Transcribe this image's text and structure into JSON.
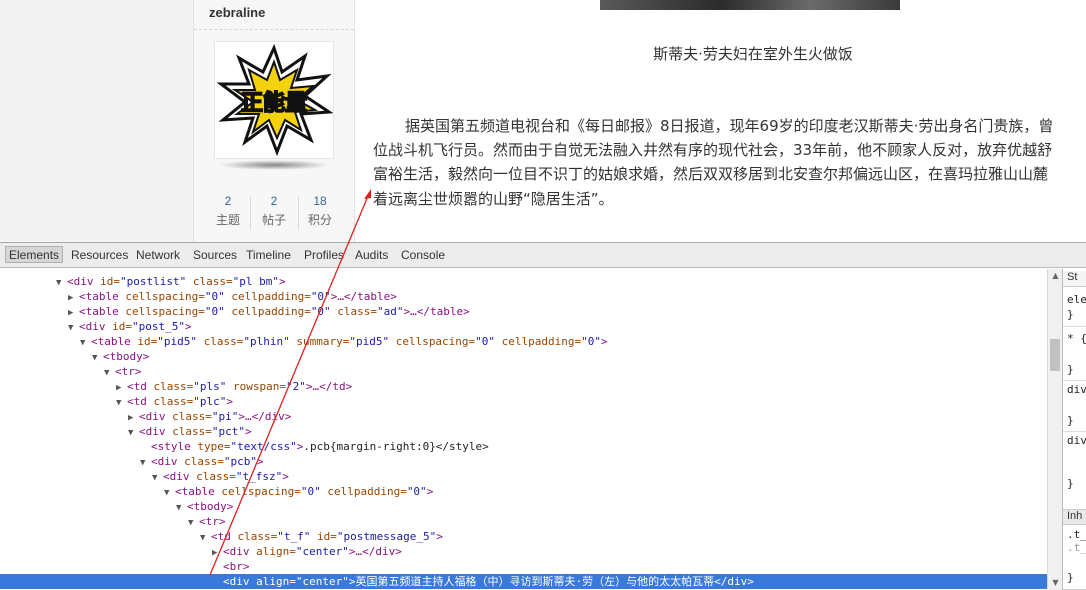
{
  "profile": {
    "username": "zebraline",
    "avatar_alt": "正能量",
    "stats": [
      {
        "value": "2",
        "label": "主题"
      },
      {
        "value": "2",
        "label": "帖子"
      },
      {
        "value": "18",
        "label": "积分"
      }
    ]
  },
  "article": {
    "caption": "斯蒂夫·劳夫妇在室外生火做饭",
    "lines": [
      "据英国第五频道电视台和《每日邮报》8日报道，现年69岁的印度老汉斯蒂夫·劳出身名门贵族，曾",
      "位战斗机飞行员。然而由于自觉无法融入井然有序的现代社会，33年前，他不顾家人反对，放弃优越舒",
      "富裕生活，毅然向一位目不识丁的姑娘求婚，然后双双移居到北安查尔邦偏远山区，在喜玛拉雅山山麓",
      "着远离尘世烦嚣的山野“隐居生活”。",
      "………………"
    ]
  },
  "devtools": {
    "tabs": [
      "Elements",
      "Resources",
      "Network",
      "Sources",
      "Timeline",
      "Profiles",
      "Audits",
      "Console"
    ],
    "active_tab": "Elements",
    "dom_lines": [
      {
        "a": "▼",
        "tag": "div",
        "attrs": [
          [
            "id",
            "postlist"
          ],
          [
            "class",
            "pl bm"
          ]
        ],
        "end": ""
      },
      {
        "a": "▶",
        "tag": "table",
        "attrs": [
          [
            "cellspacing",
            "0"
          ],
          [
            "cellpadding",
            "0"
          ]
        ],
        "end": "…</table>"
      },
      {
        "a": "▶",
        "tag": "table",
        "attrs": [
          [
            "cellspacing",
            "0"
          ],
          [
            "cellpadding",
            "0"
          ],
          [
            "class",
            "ad"
          ]
        ],
        "end": "…</table>"
      },
      {
        "a": "▼",
        "tag": "div",
        "attrs": [
          [
            "id",
            "post_5"
          ]
        ],
        "end": ""
      },
      {
        "a": "▼",
        "tag": "table",
        "attrs": [
          [
            "id",
            "pid5"
          ],
          [
            "class",
            "plhin"
          ],
          [
            "summary",
            "pid5"
          ],
          [
            "cellspacing",
            "0"
          ],
          [
            "cellpadding",
            "0"
          ]
        ],
        "end": ""
      },
      {
        "a": "▼",
        "tag": "tbody",
        "attrs": [],
        "end": ""
      },
      {
        "a": "▼",
        "tag": "tr",
        "attrs": [],
        "end": ""
      },
      {
        "a": "▶",
        "tag": "td",
        "attrs": [
          [
            "class",
            "pls"
          ],
          [
            "rowspan",
            "2"
          ]
        ],
        "end": "…</td>"
      },
      {
        "a": "▼",
        "tag": "td",
        "attrs": [
          [
            "class",
            "plc"
          ]
        ],
        "end": ""
      },
      {
        "a": "▶",
        "tag": "div",
        "attrs": [
          [
            "class",
            "pi"
          ]
        ],
        "end": "…</div>"
      },
      {
        "a": "▼",
        "tag": "div",
        "attrs": [
          [
            "class",
            "pct"
          ]
        ],
        "end": ""
      },
      {
        "a": "",
        "tag": "style",
        "attrs": [
          [
            "type",
            "text/css"
          ]
        ],
        "end": ".pcb{margin-right:0}</style>"
      },
      {
        "a": "▼",
        "tag": "div",
        "attrs": [
          [
            "class",
            "pcb"
          ]
        ],
        "end": ""
      },
      {
        "a": "▼",
        "tag": "div",
        "attrs": [
          [
            "class",
            "t_fsz"
          ]
        ],
        "end": ""
      },
      {
        "a": "▼",
        "tag": "table",
        "attrs": [
          [
            "cellspacing",
            "0"
          ],
          [
            "cellpadding",
            "0"
          ]
        ],
        "end": ""
      },
      {
        "a": "▼",
        "tag": "tbody",
        "attrs": [],
        "end": ""
      },
      {
        "a": "▼",
        "tag": "tr",
        "attrs": [],
        "end": ""
      },
      {
        "a": "▼",
        "tag": "td",
        "attrs": [
          [
            "class",
            "t_f"
          ],
          [
            "id",
            "postmessage_5"
          ]
        ],
        "end": ""
      },
      {
        "a": "▶",
        "tag": "div",
        "attrs": [
          [
            "align",
            "center"
          ]
        ],
        "end": "…</div>"
      },
      {
        "a": "",
        "tag": "br",
        "attrs": [],
        "end": ""
      },
      {
        "a": "",
        "tag": "div",
        "attrs": [
          [
            "align",
            "center"
          ]
        ],
        "end": "英国第五频道主持人福格（中）寻访到斯蒂夫·劳（左）与他的太太帕瓦蒂</div>"
      }
    ],
    "styles_pane": {
      "tab": "St",
      "rows": [
        "ele",
        "}",
        "* {",
        "}",
        "div",
        "}",
        "div",
        "}"
      ],
      "inherited_label": "Inh",
      "rows2": [
        ".t_",
        ".t_",
        "}"
      ]
    }
  }
}
